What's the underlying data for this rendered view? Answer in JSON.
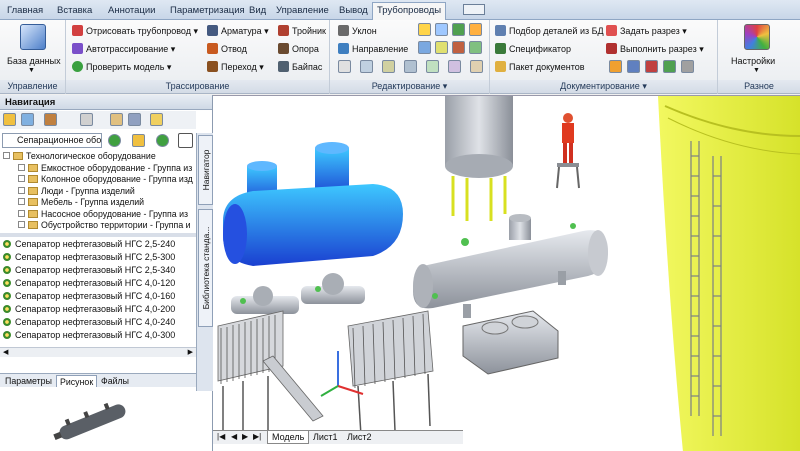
{
  "ribbon": {
    "tabs": [
      "Главная",
      "Вставка",
      "Аннотации",
      "Параметризация",
      "Вид",
      "Управление",
      "Вывод",
      "Трубопроводы"
    ],
    "active_tab": "Трубопроводы",
    "groups": {
      "manage": {
        "label": "Управление",
        "db_button": "База данных"
      },
      "route": {
        "label": "Трассирование",
        "draw_pipe": "Отрисовать трубопровод",
        "autoroute": "Автотрассирование",
        "check_model": "Проверить модель",
        "fittings": "Арматура",
        "elbow": "Отвод",
        "reducer": "Переход",
        "tee": "Тройник",
        "support": "Опора",
        "bypass": "Байпас"
      },
      "edit": {
        "label": "Редактирование",
        "slope": "Уклон",
        "direction": "Направление"
      },
      "docs": {
        "label": "Документирование",
        "pick_parts": "Подбор деталей из БД",
        "spec": "Спецификатор",
        "doc_package": "Пакет документов",
        "set_section": "Задать разрез",
        "make_section": "Выполнить разрез"
      },
      "misc": {
        "label": "Разное",
        "settings": "Настройки"
      }
    }
  },
  "navigation": {
    "title": "Навигация",
    "combo_value": "Сепарационное обор...",
    "tree": [
      "Технологическое оборудование",
      "Емкостное оборудование - Группа из",
      "Колонное оборудование - Группа изд",
      "Люди - Группа изделий",
      "Мебель - Группа изделий",
      "Насосное оборудование - Группа из",
      "Обустройство территории - Группа и"
    ],
    "list": [
      "Сепаратор нефтегазовый НГС 2,5-240",
      "Сепаратор нефтегазовый НГС 2,5-300",
      "Сепаратор нефтегазовый НГС 2,5-340",
      "Сепаратор нефтегазовый НГС 4,0-120",
      "Сепаратор нефтегазовый НГС 4,0-160",
      "Сепаратор нефтегазовый НГС 4,0-200",
      "Сепаратор нефтегазовый НГС 4,0-240",
      "Сепаратор нефтегазовый НГС 4,0-300"
    ],
    "vertical_tabs": [
      "Навигатор",
      "Библиотека станда..."
    ],
    "bottom_tabs": [
      "Параметры",
      "Рисунок",
      "Файлы"
    ],
    "active_bottom_tab": "Рисунок"
  },
  "document_tabs": [
    "Модель",
    "Лист1",
    "Лист2"
  ],
  "colors": {
    "accent": "#1a5fb4",
    "vessel_blue": "#1f6fe0",
    "equipment_gray": "#c8ccd4",
    "tank_yellow": "#e4ef40"
  }
}
